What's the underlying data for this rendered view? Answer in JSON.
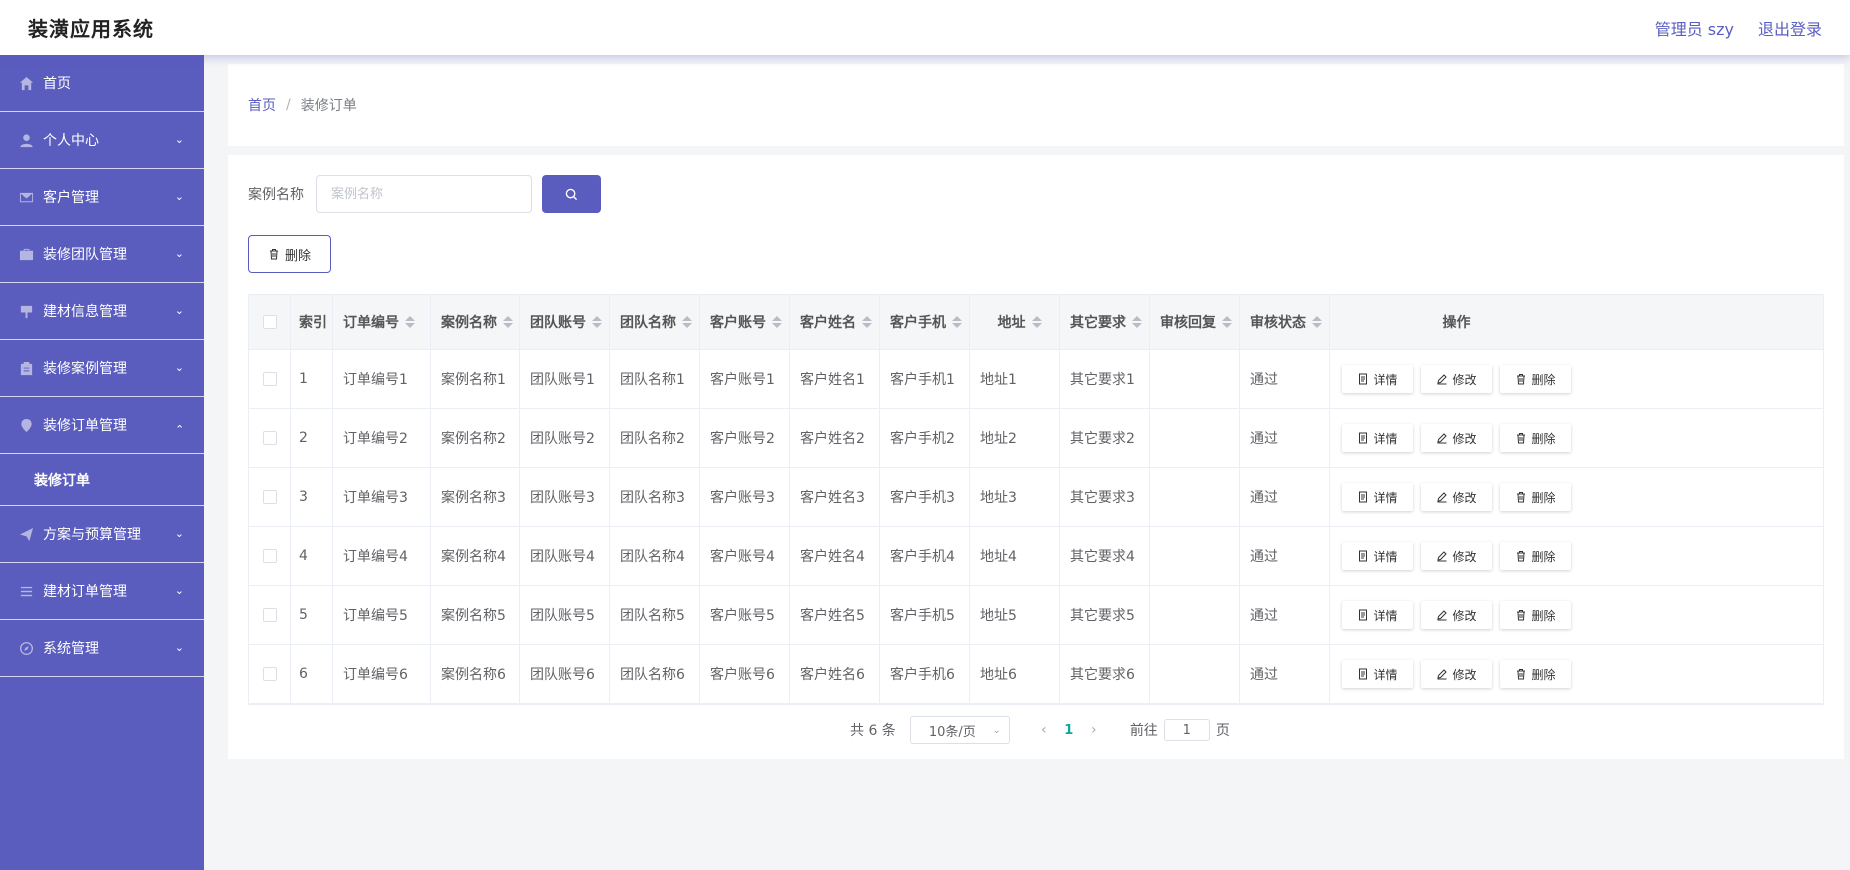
{
  "header": {
    "title": "装潢应用系统",
    "user_label": "管理员 szy",
    "logout_label": "退出登录"
  },
  "sidebar": {
    "items": [
      {
        "label": "首页",
        "icon": "home-icon",
        "expandable": false
      },
      {
        "label": "个人中心",
        "icon": "user-icon",
        "expandable": true
      },
      {
        "label": "客户管理",
        "icon": "mail-icon",
        "expandable": true
      },
      {
        "label": "装修团队管理",
        "icon": "briefcase-icon",
        "expandable": true
      },
      {
        "label": "建材信息管理",
        "icon": "brush-icon",
        "expandable": true
      },
      {
        "label": "装修案例管理",
        "icon": "clipboard-icon",
        "expandable": true
      },
      {
        "label": "装修订单管理",
        "icon": "location-icon",
        "expandable": true,
        "open": true
      },
      {
        "label": "装修订单",
        "submenu": true
      },
      {
        "label": "方案与预算管理",
        "icon": "send-icon",
        "expandable": true
      },
      {
        "label": "建材订单管理",
        "icon": "list-icon",
        "expandable": true
      },
      {
        "label": "系统管理",
        "icon": "compass-icon",
        "expandable": true
      }
    ]
  },
  "breadcrumb": {
    "home": "首页",
    "separator": "/",
    "current": "装修订单"
  },
  "search": {
    "label": "案例名称",
    "placeholder": "案例名称"
  },
  "toolbar": {
    "delete_label": "删除"
  },
  "table": {
    "columns": [
      "索引",
      "订单编号",
      "案例名称",
      "团队账号",
      "团队名称",
      "客户账号",
      "客户姓名",
      "客户手机",
      "地址",
      "其它要求",
      "审核回复",
      "审核状态",
      "操作"
    ],
    "rows": [
      {
        "index": "1",
        "order_no": "订单编号1",
        "case_name": "案例名称1",
        "team_account": "团队账号1",
        "team_name": "团队名称1",
        "customer_account": "客户账号1",
        "customer_name": "客户姓名1",
        "customer_phone": "客户手机1",
        "address": "地址1",
        "other_req": "其它要求1",
        "review_reply": "",
        "review_status": "通过"
      },
      {
        "index": "2",
        "order_no": "订单编号2",
        "case_name": "案例名称2",
        "team_account": "团队账号2",
        "team_name": "团队名称2",
        "customer_account": "客户账号2",
        "customer_name": "客户姓名2",
        "customer_phone": "客户手机2",
        "address": "地址2",
        "other_req": "其它要求2",
        "review_reply": "",
        "review_status": "通过"
      },
      {
        "index": "3",
        "order_no": "订单编号3",
        "case_name": "案例名称3",
        "team_account": "团队账号3",
        "team_name": "团队名称3",
        "customer_account": "客户账号3",
        "customer_name": "客户姓名3",
        "customer_phone": "客户手机3",
        "address": "地址3",
        "other_req": "其它要求3",
        "review_reply": "",
        "review_status": "通过"
      },
      {
        "index": "4",
        "order_no": "订单编号4",
        "case_name": "案例名称4",
        "team_account": "团队账号4",
        "team_name": "团队名称4",
        "customer_account": "客户账号4",
        "customer_name": "客户姓名4",
        "customer_phone": "客户手机4",
        "address": "地址4",
        "other_req": "其它要求4",
        "review_reply": "",
        "review_status": "通过"
      },
      {
        "index": "5",
        "order_no": "订单编号5",
        "case_name": "案例名称5",
        "team_account": "团队账号5",
        "team_name": "团队名称5",
        "customer_account": "客户账号5",
        "customer_name": "客户姓名5",
        "customer_phone": "客户手机5",
        "address": "地址5",
        "other_req": "其它要求5",
        "review_reply": "",
        "review_status": "通过"
      },
      {
        "index": "6",
        "order_no": "订单编号6",
        "case_name": "案例名称6",
        "team_account": "团队账号6",
        "team_name": "团队名称6",
        "customer_account": "客户账号6",
        "customer_name": "客户姓名6",
        "customer_phone": "客户手机6",
        "address": "地址6",
        "other_req": "其它要求6",
        "review_reply": "",
        "review_status": "通过"
      }
    ],
    "actions": {
      "detail": "详情",
      "edit": "修改",
      "delete": "删除"
    }
  },
  "pagination": {
    "total_text": "共 6 条",
    "page_size": "10条/页",
    "current_page": "1",
    "goto_label": "前往",
    "goto_value": "1",
    "page_suffix": "页"
  },
  "colors": {
    "primary": "#5a5cbe",
    "sidebar_bg": "#5a5cbe",
    "active_page": "#0fa795"
  }
}
